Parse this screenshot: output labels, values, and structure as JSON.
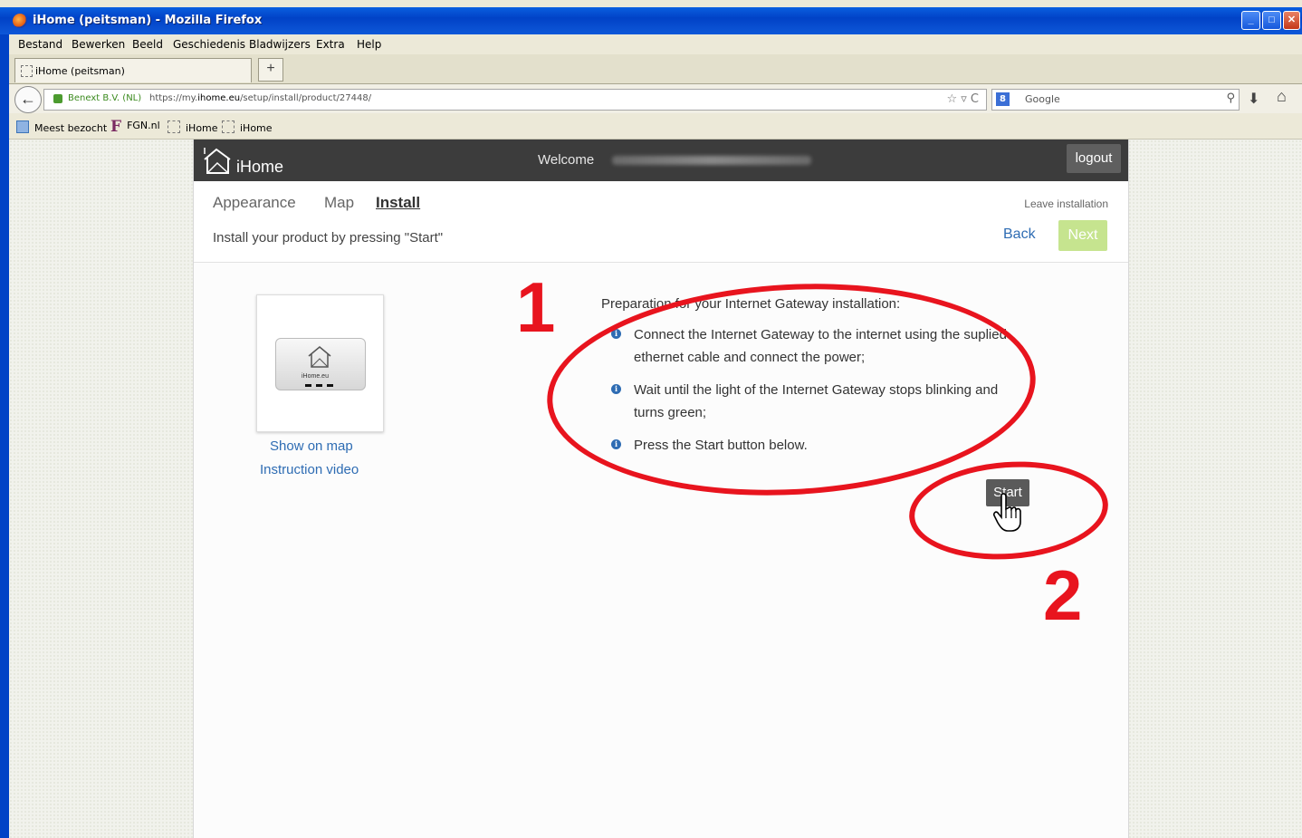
{
  "window": {
    "title": "iHome (peitsman) - Mozilla Firefox",
    "minimize": "_",
    "maximize": "□",
    "close": "✕"
  },
  "menu": [
    "Bestand",
    "Bewerken",
    "Beeld",
    "Geschiedenis",
    "Bladwijzers",
    "Extra",
    "Help"
  ],
  "tab": {
    "label": "iHome (peitsman)",
    "new_tab": "+"
  },
  "navbar": {
    "back": "←",
    "identity": "Benext B.V. (NL)",
    "url_prefix": "https://my.",
    "url_domain": "ihome.eu",
    "url_path": "/setup/install/product/27448/",
    "url_tools": "☆ ▿ C",
    "search_engine": "8",
    "search_placeholder": "Google",
    "search_icon": "⚲",
    "download_icon": "⬇",
    "home_icon": "⌂"
  },
  "bookmarks": [
    "Meest bezocht",
    "FGN.nl",
    "iHome",
    "iHome"
  ],
  "app": {
    "logo": "iHome",
    "welcome": "Welcome",
    "logout": "logout",
    "tabs": [
      "Appearance",
      "Map",
      "Install"
    ],
    "active_tab": "Install",
    "leave": "Leave installation",
    "hint": "Install your product by pressing \"Start\"",
    "back": "Back",
    "next": "Next",
    "device_label": "iHome.eu",
    "show_on_map": "Show on map",
    "instruction_video": "Instruction video",
    "prep_title": "Preparation for your Internet Gateway installation:",
    "steps": [
      "Connect the Internet Gateway to the internet using the suplied ethernet cable and connect the power;",
      "Wait until the light of the Internet Gateway stops blinking and turns green;",
      "Press the Start button below."
    ],
    "info_glyph": "i",
    "start": "Start"
  },
  "annotations": {
    "one": "1",
    "two": "2",
    "color": "#e8141e"
  }
}
